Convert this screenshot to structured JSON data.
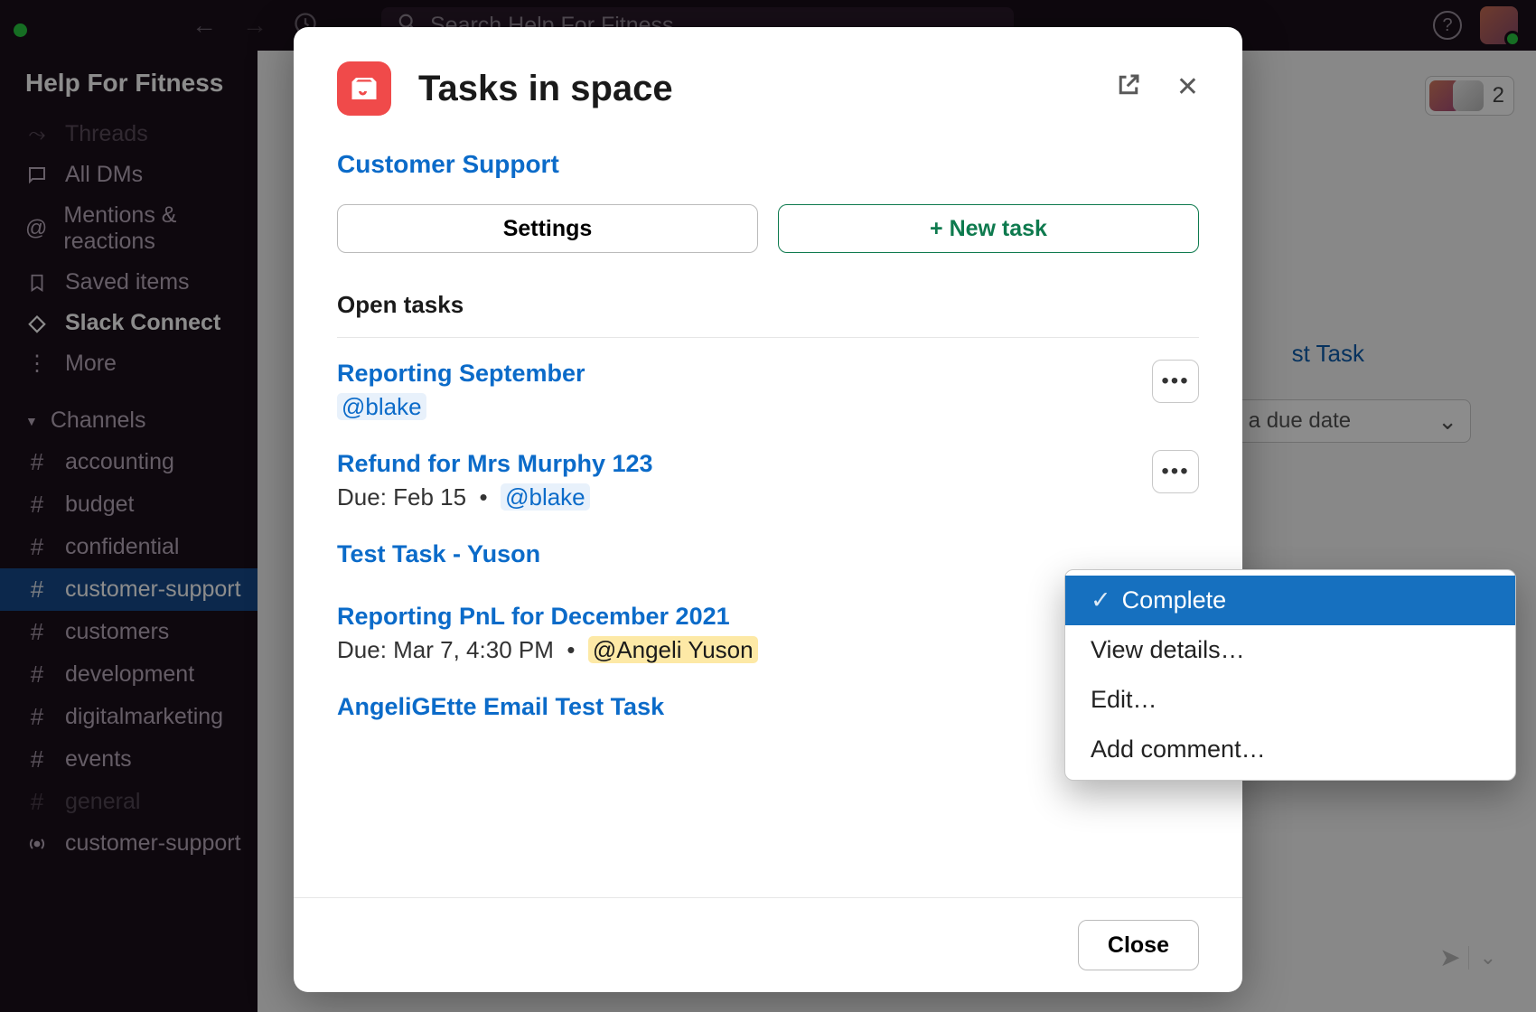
{
  "search": {
    "placeholder": "Search Help For Fitness"
  },
  "workspace": "Help For Fitness",
  "sidebar": {
    "items": [
      {
        "label": "Threads"
      },
      {
        "label": "All DMs"
      },
      {
        "label": "Mentions & reactions"
      },
      {
        "label": "Saved items"
      },
      {
        "label": "Slack Connect"
      },
      {
        "label": "More"
      }
    ],
    "channels_header": "Channels",
    "channels": [
      {
        "name": "accounting"
      },
      {
        "name": "budget"
      },
      {
        "name": "confidential"
      },
      {
        "name": "customer-support",
        "active": true
      },
      {
        "name": "customers"
      },
      {
        "name": "development"
      },
      {
        "name": "digitalmarketing"
      },
      {
        "name": "events"
      },
      {
        "name": "general"
      },
      {
        "name": "customer-support",
        "icon": "radio"
      }
    ]
  },
  "members": {
    "count": "2"
  },
  "right": {
    "label": "st Task",
    "select": "ect a due date"
  },
  "modal": {
    "title": "Tasks in space",
    "space": "Customer Support",
    "settings_btn": "Settings",
    "new_task_btn": "+ New task",
    "section": "Open tasks",
    "tasks": [
      {
        "title": "Reporting September",
        "sub_mentions": [
          "@blake"
        ]
      },
      {
        "title": "Refund for Mrs Murphy 123",
        "due": "Due: Feb 15",
        "sub_mentions": [
          "@blake"
        ]
      },
      {
        "title": "Test Task - Yuson"
      },
      {
        "title": "Reporting PnL for December 2021",
        "due": "Due: Mar 7, 4:30 PM",
        "sub_mentions": [
          "@Angeli Yuson"
        ],
        "amber": true
      },
      {
        "title": "AngeliGEtte Email Test Task"
      }
    ],
    "close_btn": "Close"
  },
  "menu": {
    "items": [
      {
        "label": "Complete",
        "check": true,
        "active": true
      },
      {
        "label": "View details…"
      },
      {
        "label": "Edit…"
      },
      {
        "label": "Add comment…"
      }
    ]
  }
}
